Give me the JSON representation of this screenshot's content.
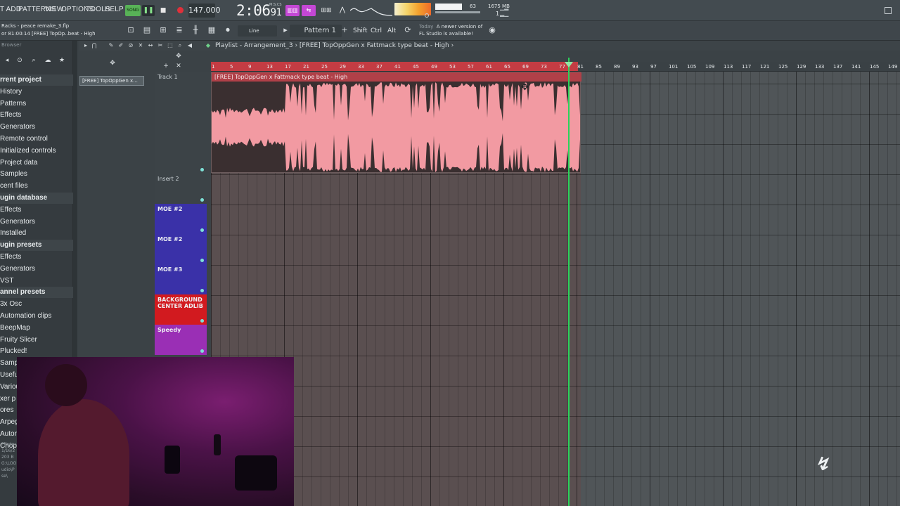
{
  "menu": {
    "items": [
      "T ADD",
      "PATTERNS",
      "VIEW",
      "OPTIONS",
      "TOOLS",
      "HELP"
    ]
  },
  "transport": {
    "song_mode": "SONG",
    "tempo": "147.000",
    "time": "2:06",
    "time_sub": "91",
    "time_label": "M:S:CS"
  },
  "stats": {
    "cpu": "63",
    "memory": "1675 MB",
    "polyphony": "1"
  },
  "project": {
    "name": "Racks - peace remake_3.flp",
    "hint": "or 81:00:14      [FREE] TopOp..beat - High"
  },
  "toolbar2": {
    "snap": "Line",
    "pattern": "Pattern 1",
    "keys": [
      "Shift",
      "Ctrl",
      "Alt"
    ],
    "news_when": "Today",
    "news_text1": "A newer version of",
    "news_text2": "FL Studio is available!"
  },
  "browser": {
    "header": "Browser",
    "items": [
      {
        "label": "rrent project",
        "section": true
      },
      {
        "label": "History",
        "section": false
      },
      {
        "label": "Patterns",
        "section": false
      },
      {
        "label": "Effects",
        "section": false
      },
      {
        "label": "Generators",
        "section": false
      },
      {
        "label": "Remote control",
        "section": false
      },
      {
        "label": "Initialized controls",
        "section": false
      },
      {
        "label": "Project data",
        "section": false
      },
      {
        "label": "Samples",
        "section": false
      },
      {
        "label": "cent files",
        "section": false
      },
      {
        "label": "ugin database",
        "section": true
      },
      {
        "label": "Effects",
        "section": false
      },
      {
        "label": "Generators",
        "section": false
      },
      {
        "label": "Installed",
        "section": false
      },
      {
        "label": "ugin presets",
        "section": true
      },
      {
        "label": "Effects",
        "section": false
      },
      {
        "label": "Generators",
        "section": false
      },
      {
        "label": "VST",
        "section": false
      },
      {
        "label": "annel presets",
        "section": true
      },
      {
        "label": "3x Osc",
        "section": false
      },
      {
        "label": "Automation clips",
        "section": false
      },
      {
        "label": "BeepMap",
        "section": false
      },
      {
        "label": "Fruity Slicer",
        "section": false
      },
      {
        "label": "Plucked!",
        "section": false
      },
      {
        "label": "Sampler",
        "section": false
      },
      {
        "label": "Usefu",
        "section": false
      },
      {
        "label": "Variou",
        "section": false
      },
      {
        "label": "xer p",
        "section": false
      },
      {
        "label": "ores",
        "section": false
      },
      {
        "label": "Arpeg",
        "section": false
      },
      {
        "label": "Autom",
        "section": false
      },
      {
        "label": "Chopp",
        "section": false
      }
    ],
    "plugin_info": [
      "Plugin",
      "1/16/2",
      "203 B",
      "G:\\LOO",
      "udio\\P",
      "se\\"
    ]
  },
  "channel": {
    "selected_track": "[FREE] TopOppGen x..."
  },
  "playlist": {
    "title": "Playlist - Arrangement_3",
    "clip_path": "[FREE] TopOppGen x Fattmack type beat - High",
    "clip_title": "[FREE] TopOppGen x Fattmack type beat - High",
    "ruler": [
      "1",
      "5",
      "9",
      "13",
      "17",
      "21",
      "25",
      "29",
      "33",
      "37",
      "41",
      "45",
      "49",
      "53",
      "57",
      "61",
      "65",
      "69",
      "73",
      "77",
      "81",
      "85",
      "89",
      "93",
      "97",
      "101",
      "105",
      "109",
      "113",
      "117",
      "121",
      "125",
      "129",
      "133",
      "137",
      "141",
      "145",
      "149"
    ],
    "tracks": [
      {
        "name": "Track 1",
        "color": "#3c4347"
      },
      {
        "name": "Insert 2",
        "color": "#3c4347"
      },
      {
        "name": "MOE #2",
        "color": "#3a31a8"
      },
      {
        "name": "MOE #2",
        "color": "#3a31a8"
      },
      {
        "name": "MOE #3",
        "color": "#3a31a8"
      },
      {
        "name": "BACKGROUND CENTER ADLIB",
        "color": "#d21a1f"
      },
      {
        "name": "Speedy",
        "color": "#9a2fb5"
      }
    ]
  },
  "colors": {
    "accent": "#c447d5",
    "clip_wave": "#f29aa2",
    "playhead": "#2ad45a"
  }
}
